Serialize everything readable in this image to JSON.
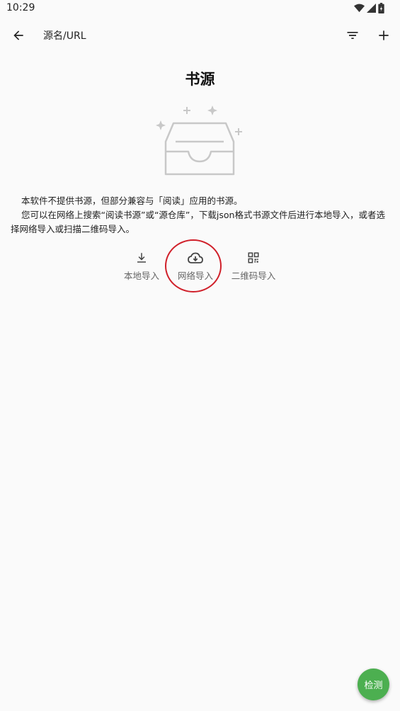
{
  "status_bar": {
    "time": "10:29",
    "icons": [
      "wifi-icon",
      "signal-icon",
      "battery-icon"
    ]
  },
  "toolbar": {
    "back_icon": "arrow-back-icon",
    "search_label": "源名/URL",
    "filter_icon": "filter-icon",
    "add_icon": "plus-icon"
  },
  "page": {
    "title": "书源",
    "illustration": "empty-inbox-icon",
    "description_line1": "本软件不提供书源，但部分兼容与「阅读」应用的书源。",
    "description_line2": "您可以在网络上搜索“阅读书源”或“源仓库”，下载json格式书源文件后进行本地导入，或者选择网络导入或扫描二维码导入。"
  },
  "import_actions": [
    {
      "label": "本地导入",
      "icon": "download-icon"
    },
    {
      "label": "网络导入",
      "icon": "cloud-download-icon"
    },
    {
      "label": "二维码导入",
      "icon": "qr-code-icon"
    }
  ],
  "fab": {
    "label": "检测"
  },
  "colors": {
    "fab": "#4caf50",
    "highlight": "#d0202a",
    "background": "#fafafa"
  }
}
